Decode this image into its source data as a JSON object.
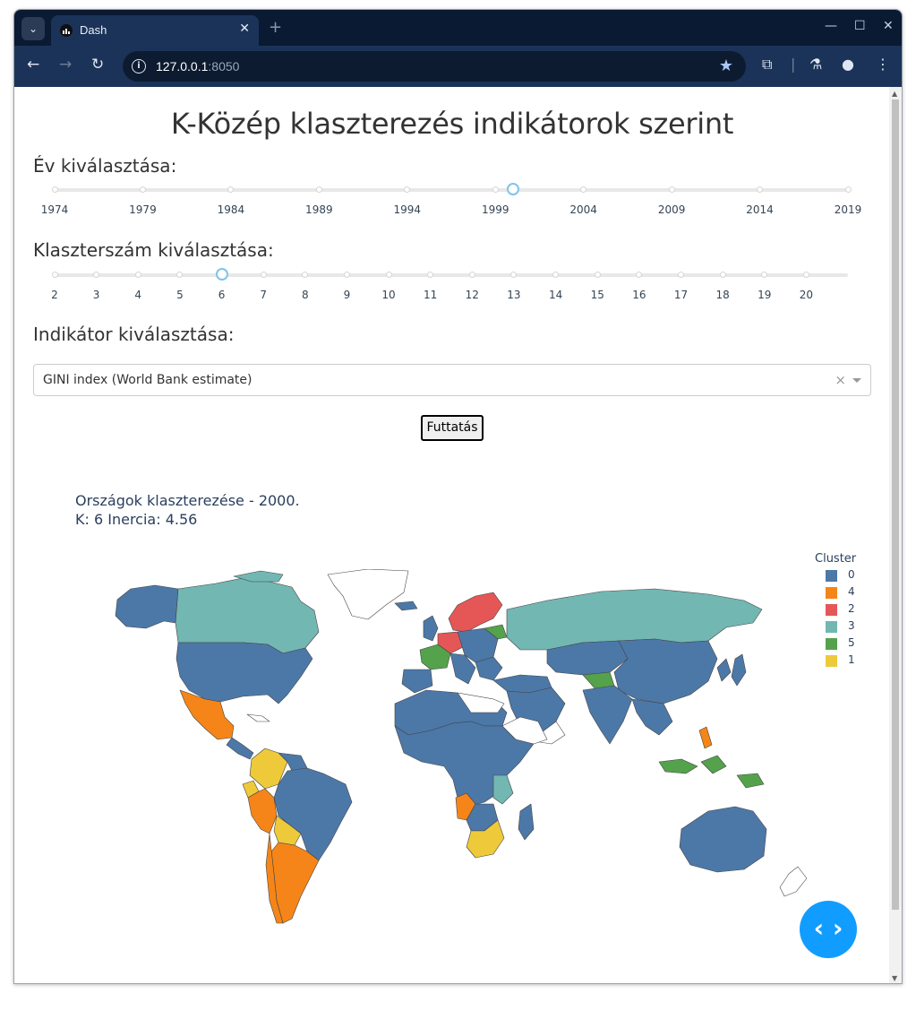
{
  "browser": {
    "tab_title": "Dash",
    "url_host": "127.0.0.1",
    "url_port": ":8050"
  },
  "page": {
    "title": "K-Közép klaszterezés indikátorok szerint",
    "year_label": "Év kiválasztása:",
    "year_marks": [
      "1974",
      "1979",
      "1984",
      "1989",
      "1994",
      "1999",
      "2004",
      "2009",
      "2014",
      "2019"
    ],
    "year_selected": 2000,
    "cluster_label": "Klaszterszám kiválasztása:",
    "cluster_marks": [
      "2",
      "3",
      "4",
      "5",
      "6",
      "7",
      "8",
      "9",
      "10",
      "11",
      "12",
      "13",
      "14",
      "15",
      "16",
      "17",
      "18",
      "19",
      "20"
    ],
    "cluster_selected": 6,
    "indicator_label": "Indikátor kiválasztása:",
    "indicator_value": "GINI index (World Bank estimate)",
    "run_button": "Futtatás"
  },
  "map": {
    "title_line1": "Országok klaszterezése - 2000.",
    "title_line2": "K: 6 Inercia: 4.56",
    "legend_title": "Cluster",
    "legend": [
      {
        "label": "0",
        "color": "#4c78a8"
      },
      {
        "label": "4",
        "color": "#f58518"
      },
      {
        "label": "2",
        "color": "#e45756"
      },
      {
        "label": "3",
        "color": "#72b7b2"
      },
      {
        "label": "5",
        "color": "#54a24b"
      },
      {
        "label": "1",
        "color": "#eeca3b"
      }
    ]
  },
  "icons": {
    "fab": "code-icon"
  }
}
